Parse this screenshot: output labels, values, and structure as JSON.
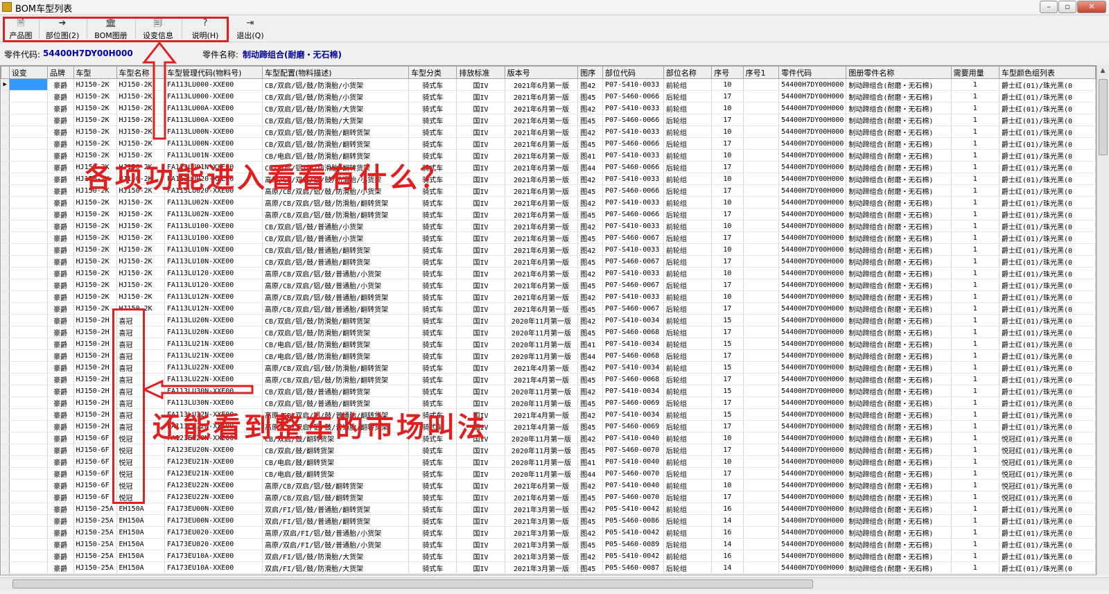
{
  "window": {
    "title": "BOM车型列表",
    "controls": [
      "–",
      "▫",
      "✕"
    ]
  },
  "toolbar": {
    "buttons": [
      {
        "label": "产品图",
        "icon": "🗎"
      },
      {
        "label": "部位图(2)",
        "icon": "➔"
      },
      {
        "label": "BOM图册",
        "icon": "🏛"
      },
      {
        "label": "设变信息",
        "icon": "🗐"
      },
      {
        "label": "说明(H)",
        "icon": "?"
      },
      {
        "label": "退出(Q)",
        "icon": "⇥"
      }
    ]
  },
  "info": {
    "part_code_label": "零件代码:",
    "part_code": "54400H7DY00H000",
    "part_name_label": "零件名称:",
    "part_name": "制动蹄组合(耐磨・无石棉)"
  },
  "grid": {
    "columns": [
      "设变",
      "品牌",
      "车型",
      "车型名称",
      "车型管理代码(物料号)",
      "车型配置(物料描述)",
      "车型分类",
      "排放标准",
      "版本号",
      "图序",
      "部位代码",
      "部位名称",
      "序号",
      "序号1",
      "零件代码",
      "图册零件名称",
      "需要用量",
      "车型颜色组列表"
    ],
    "common": {
      "brand": "豪爵",
      "cls": "骑式车",
      "emis": "国IV",
      "part": "54400H7DY00H000",
      "pname": "制动蹄组合(耐磨・无石棉)",
      "qty": "1"
    },
    "rows": [
      [
        "HJ150-2K",
        "HJ150-2K",
        "FA113LU000-XXE00",
        "CB/双启/铝/鼓/防滑胎/小货架",
        "2021年6月第一版",
        "图42",
        "P07-S410-0033",
        "前轮组",
        "10",
        "爵士红(01)/珠光黑(0"
      ],
      [
        "HJ150-2K",
        "HJ150-2K",
        "FA113LU000-XXE00",
        "CB/双启/铝/鼓/防滑胎/小货架",
        "2021年6月第一版",
        "图45",
        "P07-S460-0066",
        "后轮组",
        "17",
        "爵士红(01)/珠光黑(0"
      ],
      [
        "HJ150-2K",
        "HJ150-2K",
        "FA113LU00A-XXE00",
        "CB/双启/铝/鼓/防滑胎/大货架",
        "2021年6月第一版",
        "图42",
        "P07-S410-0033",
        "前轮组",
        "10",
        "爵士红(01)/珠光黑(0"
      ],
      [
        "HJ150-2K",
        "HJ150-2K",
        "FA113LU00A-XXE00",
        "CB/双启/铝/鼓/防滑胎/大货架",
        "2021年6月第一版",
        "图45",
        "P07-S460-0066",
        "后轮组",
        "17",
        "爵士红(01)/珠光黑(0"
      ],
      [
        "HJ150-2K",
        "HJ150-2K",
        "FA113LU00N-XXE00",
        "CB/双启/铝/鼓/防滑胎/翻转货架",
        "2021年6月第一版",
        "图42",
        "P07-S410-0033",
        "前轮组",
        "10",
        "爵士红(01)/珠光黑(0"
      ],
      [
        "HJ150-2K",
        "HJ150-2K",
        "FA113LU00N-XXE00",
        "CB/双启/铝/鼓/防滑胎/翻转货架",
        "2021年6月第一版",
        "图45",
        "P07-S460-0066",
        "后轮组",
        "17",
        "爵士红(01)/珠光黑(0"
      ],
      [
        "HJ150-2K",
        "HJ150-2K",
        "FA113LU01N-XXE00",
        "CB/电启/铝/鼓/防滑胎/翻转货架",
        "2021年6月第一版",
        "图41",
        "P07-S410-0033",
        "前轮组",
        "10",
        "爵士红(01)/珠光黑(0"
      ],
      [
        "HJ150-2K",
        "HJ150-2K",
        "FA113LU01N-XXE00",
        "CB/电启/铝/鼓/防滑胎/翻转货架",
        "2021年6月第一版",
        "图44",
        "P07-S460-0066",
        "后轮组",
        "17",
        "爵士红(01)/珠光黑(0"
      ],
      [
        "HJ150-2K",
        "HJ150-2K",
        "FA113LU020-XXE00",
        "高原/CB/双启/铝/鼓/防滑胎/小货架",
        "2021年6月第一版",
        "图42",
        "P07-S410-0033",
        "前轮组",
        "10",
        "爵士红(01)/珠光黑(0"
      ],
      [
        "HJ150-2K",
        "HJ150-2K",
        "FA113LU020-XXE00",
        "高原/CB/双启/铝/鼓/防滑胎/小货架",
        "2021年6月第一版",
        "图45",
        "P07-S460-0066",
        "后轮组",
        "17",
        "爵士红(01)/珠光黑(0"
      ],
      [
        "HJ150-2K",
        "HJ150-2K",
        "FA113LU02N-XXE00",
        "高原/CB/双启/铝/鼓/防滑胎/翻转货架",
        "2021年6月第一版",
        "图42",
        "P07-S410-0033",
        "前轮组",
        "10",
        "爵士红(01)/珠光黑(0"
      ],
      [
        "HJ150-2K",
        "HJ150-2K",
        "FA113LU02N-XXE00",
        "高原/CB/双启/铝/鼓/防滑胎/翻转货架",
        "2021年6月第一版",
        "图45",
        "P07-S460-0066",
        "后轮组",
        "17",
        "爵士红(01)/珠光黑(0"
      ],
      [
        "HJ150-2K",
        "HJ150-2K",
        "FA113LU100-XXE00",
        "CB/双启/铝/鼓/普通胎/小货架",
        "2021年6月第一版",
        "图42",
        "P07-S410-0033",
        "前轮组",
        "10",
        "爵士红(01)/珠光黑(0"
      ],
      [
        "HJ150-2K",
        "HJ150-2K",
        "FA113LU100-XXE00",
        "CB/双启/铝/鼓/普通胎/小货架",
        "2021年6月第一版",
        "图45",
        "P07-S460-0067",
        "后轮组",
        "17",
        "爵士红(01)/珠光黑(0"
      ],
      [
        "HJ150-2K",
        "HJ150-2K",
        "FA113LU10N-XXE00",
        "CB/双启/铝/鼓/普通胎/翻转货架",
        "2021年6月第一版",
        "图42",
        "P07-S410-0033",
        "前轮组",
        "10",
        "爵士红(01)/珠光黑(0"
      ],
      [
        "HJ150-2K",
        "HJ150-2K",
        "FA113LU10N-XXE00",
        "CB/双启/铝/鼓/普通胎/翻转货架",
        "2021年6月第一版",
        "图45",
        "P07-S460-0067",
        "后轮组",
        "17",
        "爵士红(01)/珠光黑(0"
      ],
      [
        "HJ150-2K",
        "HJ150-2K",
        "FA113LU120-XXE00",
        "高原/CB/双启/铝/鼓/普通胎/小货架",
        "2021年6月第一版",
        "图42",
        "P07-S410-0033",
        "前轮组",
        "10",
        "爵士红(01)/珠光黑(0"
      ],
      [
        "HJ150-2K",
        "HJ150-2K",
        "FA113LU120-XXE00",
        "高原/CB/双启/铝/鼓/普通胎/小货架",
        "2021年6月第一版",
        "图45",
        "P07-S460-0067",
        "后轮组",
        "17",
        "爵士红(01)/珠光黑(0"
      ],
      [
        "HJ150-2K",
        "HJ150-2K",
        "FA113LU12N-XXE00",
        "高原/CB/双启/铝/鼓/普通胎/翻转货架",
        "2021年6月第一版",
        "图42",
        "P07-S410-0033",
        "前轮组",
        "10",
        "爵士红(01)/珠光黑(0"
      ],
      [
        "HJ150-2K",
        "HJ150-2K",
        "FA113LU12N-XXE00",
        "高原/CB/双启/铝/鼓/普通胎/翻转货架",
        "2021年6月第一版",
        "图45",
        "P07-S460-0067",
        "后轮组",
        "17",
        "爵士红(01)/珠光黑(0"
      ],
      [
        "HJ150-2H",
        "喜冠",
        "FA113LU20N-XXE00",
        "CB/双启/铝/鼓/防滑胎/翻转货架",
        "2020年11月第一版",
        "图42",
        "P07-S410-0034",
        "前轮组",
        "15",
        "爵士红(01)/珠光黑(0"
      ],
      [
        "HJ150-2H",
        "喜冠",
        "FA113LU20N-XXE00",
        "CB/双启/铝/鼓/防滑胎/翻转货架",
        "2020年11月第一版",
        "图45",
        "P07-S460-0068",
        "后轮组",
        "17",
        "爵士红(01)/珠光黑(0"
      ],
      [
        "HJ150-2H",
        "喜冠",
        "FA113LU21N-XXE00",
        "CB/电启/铝/鼓/防滑胎/翻转货架",
        "2020年11月第一版",
        "图41",
        "P07-S410-0034",
        "前轮组",
        "15",
        "爵士红(01)/珠光黑(0"
      ],
      [
        "HJ150-2H",
        "喜冠",
        "FA113LU21N-XXE00",
        "CB/电启/铝/鼓/防滑胎/翻转货架",
        "2020年11月第一版",
        "图44",
        "P07-S460-0068",
        "后轮组",
        "17",
        "爵士红(01)/珠光黑(0"
      ],
      [
        "HJ150-2H",
        "喜冠",
        "FA113LU22N-XXE00",
        "高原/CB/双启/铝/鼓/防滑胎/翻转货架",
        "2021年4月第一版",
        "图42",
        "P07-S410-0034",
        "前轮组",
        "15",
        "爵士红(01)/珠光黑(0"
      ],
      [
        "HJ150-2H",
        "喜冠",
        "FA113LU22N-XXE00",
        "高原/CB/双启/铝/鼓/防滑胎/翻转货架",
        "2021年4月第一版",
        "图45",
        "P07-S460-0068",
        "后轮组",
        "17",
        "爵士红(01)/珠光黑(0"
      ],
      [
        "HJ150-2H",
        "喜冠",
        "FA113LU30N-XXE00",
        "CB/双启/铝/鼓/普通胎/翻转货架",
        "2020年11月第一版",
        "图42",
        "P07-S410-0034",
        "前轮组",
        "15",
        "爵士红(01)/珠光黑(0"
      ],
      [
        "HJ150-2H",
        "喜冠",
        "FA113LU30N-XXE00",
        "CB/双启/铝/鼓/普通胎/翻转货架",
        "2020年11月第一版",
        "图45",
        "P07-S460-0069",
        "后轮组",
        "17",
        "爵士红(01)/珠光黑(0"
      ],
      [
        "HJ150-2H",
        "喜冠",
        "FA113LU32N-XXE00",
        "高原/CB/双启/铝/鼓/普通胎/翻转货架",
        "2021年4月第一版",
        "图42",
        "P07-S410-0034",
        "前轮组",
        "15",
        "爵士红(01)/珠光黑(0"
      ],
      [
        "HJ150-2H",
        "喜冠",
        "FA113LU32N-XXE00",
        "高原/CB/双启/铝/鼓/普通胎/翻转货架",
        "2021年4月第一版",
        "图45",
        "P07-S460-0069",
        "后轮组",
        "17",
        "爵士红(01)/珠光黑(0"
      ],
      [
        "HJ150-6F",
        "悦冠",
        "FA123EU20N-XXE00",
        "CB/双启/鼓/翻转货架",
        "2020年11月第一版",
        "图42",
        "P07-S410-0040",
        "前轮组",
        "10",
        "悦冠红(01)/珠光黑(0"
      ],
      [
        "HJ150-6F",
        "悦冠",
        "FA123EU20N-XXE00",
        "CB/双启/鼓/翻转货架",
        "2020年11月第一版",
        "图45",
        "P07-S460-0070",
        "后轮组",
        "17",
        "悦冠红(01)/珠光黑(0"
      ],
      [
        "HJ150-6F",
        "悦冠",
        "FA123EU21N-XXE00",
        "CB/电启/鼓/翻转货架",
        "2020年11月第一版",
        "图41",
        "P07-S410-0040",
        "前轮组",
        "10",
        "悦冠红(01)/珠光黑(0"
      ],
      [
        "HJ150-6F",
        "悦冠",
        "FA123EU21N-XXE00",
        "CB/电启/鼓/翻转货架",
        "2020年11月第一版",
        "图44",
        "P07-S460-0070",
        "后轮组",
        "17",
        "悦冠红(01)/珠光黑(0"
      ],
      [
        "HJ150-6F",
        "悦冠",
        "FA123EU22N-XXE00",
        "高原/CB/双启/铝/鼓/翻转货架",
        "2021年6月第一版",
        "图42",
        "P07-S410-0040",
        "前轮组",
        "10",
        "悦冠红(01)/珠光黑(0"
      ],
      [
        "HJ150-6F",
        "悦冠",
        "FA123EU22N-XXE00",
        "高原/CB/双启/铝/鼓/翻转货架",
        "2021年6月第一版",
        "图45",
        "P07-S460-0070",
        "后轮组",
        "17",
        "悦冠红(01)/珠光黑(0"
      ],
      [
        "HJ150-25A",
        "EH150A",
        "FA173EU00N-XXE00",
        "双启/FI/铝/鼓/普通胎/翻转货架",
        "2021年3月第一版",
        "图42",
        "P05-S410-0042",
        "前轮组",
        "16",
        "爵士红(01)/珠光黑(0"
      ],
      [
        "HJ150-25A",
        "EH150A",
        "FA173EU00N-XXE00",
        "双启/FI/铝/鼓/普通胎/翻转货架",
        "2021年3月第一版",
        "图45",
        "P05-S460-0086",
        "后轮组",
        "14",
        "爵士红(01)/珠光黑(0"
      ],
      [
        "HJ150-25A",
        "EH150A",
        "FA173EU020-XXE00",
        "高原/双启/FI/铝/鼓/普通胎/小货架",
        "2021年3月第一版",
        "图42",
        "P05-S410-0042",
        "前轮组",
        "16",
        "爵士红(01)/珠光黑(0"
      ],
      [
        "HJ150-25A",
        "EH150A",
        "FA173EU020-XXE00",
        "高原/双启/FI/铝/鼓/普通胎/小货架",
        "2021年3月第一版",
        "图45",
        "P05-S460-0089",
        "后轮组",
        "14",
        "爵士红(01)/珠光黑(0"
      ],
      [
        "HJ150-25A",
        "EH150A",
        "FA173EU10A-XXE00",
        "双启/FI/铝/鼓/防滑胎/大货架",
        "2021年3月第一版",
        "图42",
        "P05-S410-0042",
        "前轮组",
        "16",
        "爵士红(01)/珠光黑(0"
      ],
      [
        "HJ150-25A",
        "EH150A",
        "FA173EU10A-XXE00",
        "双启/FI/铝/鼓/防滑胎/大货架",
        "2021年3月第一版",
        "图45",
        "P05-S460-0087",
        "后轮组",
        "14",
        "爵士红(01)/珠光黑(0"
      ]
    ]
  },
  "annotations": {
    "text1": "各项功能进入看看有什么？",
    "text2": "还能看到整车的市场叫法"
  },
  "colors": {
    "annotation": "#e02020",
    "selection": "#3399ff",
    "value_blue": "#0000a0"
  }
}
